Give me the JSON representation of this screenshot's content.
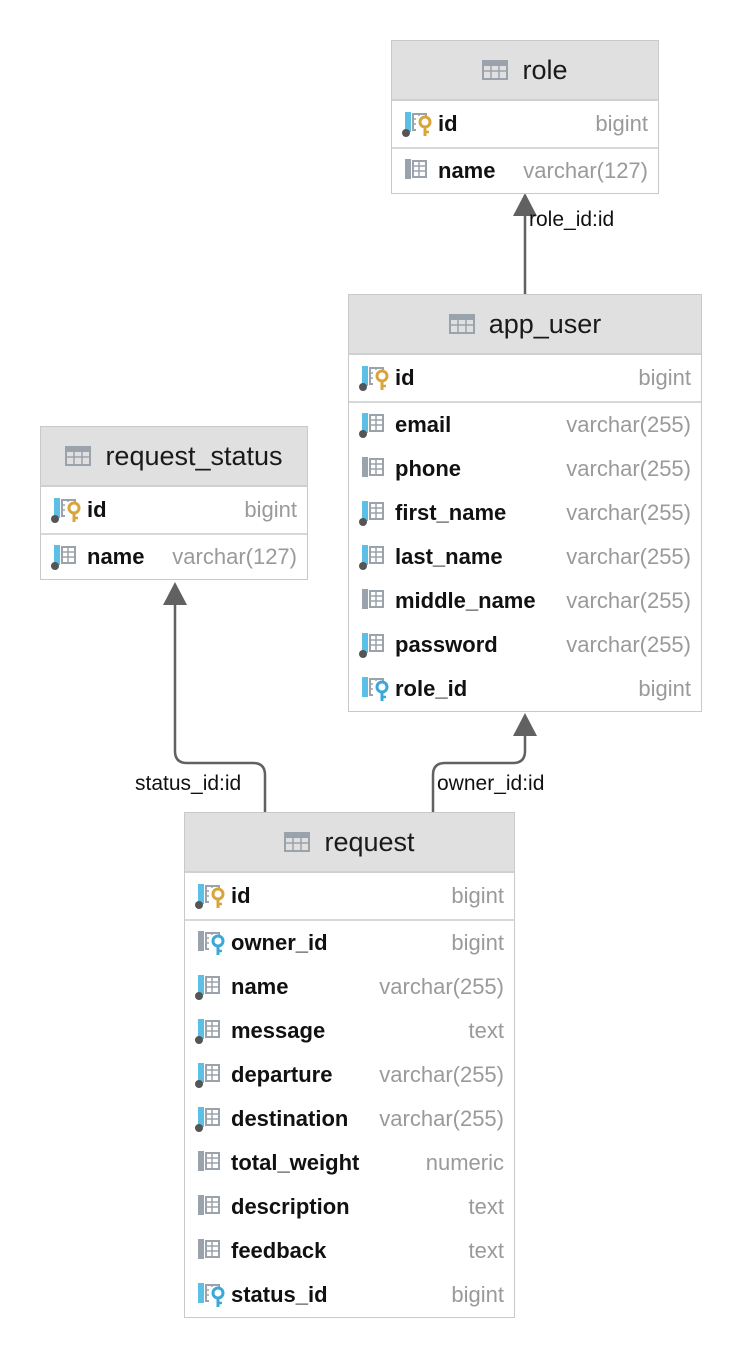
{
  "entities": {
    "role": {
      "title": "role",
      "columns": [
        {
          "name": "id",
          "type": "bigint",
          "kind": "pk"
        },
        {
          "name": "name",
          "type": "varchar(127)",
          "kind": "plain"
        }
      ]
    },
    "app_user": {
      "title": "app_user",
      "columns": [
        {
          "name": "id",
          "type": "bigint",
          "kind": "pk"
        },
        {
          "name": "email",
          "type": "varchar(255)",
          "kind": "notnull"
        },
        {
          "name": "phone",
          "type": "varchar(255)",
          "kind": "plain"
        },
        {
          "name": "first_name",
          "type": "varchar(255)",
          "kind": "notnull"
        },
        {
          "name": "last_name",
          "type": "varchar(255)",
          "kind": "notnull"
        },
        {
          "name": "middle_name",
          "type": "varchar(255)",
          "kind": "plain"
        },
        {
          "name": "password",
          "type": "varchar(255)",
          "kind": "notnull"
        },
        {
          "name": "role_id",
          "type": "bigint",
          "kind": "fk"
        }
      ]
    },
    "request_status": {
      "title": "request_status",
      "columns": [
        {
          "name": "id",
          "type": "bigint",
          "kind": "pk"
        },
        {
          "name": "name",
          "type": "varchar(127)",
          "kind": "notnull"
        }
      ]
    },
    "request": {
      "title": "request",
      "columns": [
        {
          "name": "id",
          "type": "bigint",
          "kind": "pk"
        },
        {
          "name": "owner_id",
          "type": "bigint",
          "kind": "fk-plain"
        },
        {
          "name": "name",
          "type": "varchar(255)",
          "kind": "notnull"
        },
        {
          "name": "message",
          "type": "text",
          "kind": "notnull"
        },
        {
          "name": "departure",
          "type": "varchar(255)",
          "kind": "notnull"
        },
        {
          "name": "destination",
          "type": "varchar(255)",
          "kind": "notnull"
        },
        {
          "name": "total_weight",
          "type": "numeric",
          "kind": "plain"
        },
        {
          "name": "description",
          "type": "text",
          "kind": "plain"
        },
        {
          "name": "feedback",
          "type": "text",
          "kind": "plain"
        },
        {
          "name": "status_id",
          "type": "bigint",
          "kind": "fk"
        }
      ]
    }
  },
  "relations": [
    {
      "label": "role_id:id"
    },
    {
      "label": "status_id:id"
    },
    {
      "label": "owner_id:id"
    }
  ],
  "colors": {
    "key": "#d9a53a",
    "fk": "#3aa8d8",
    "icon_blue": "#5bbfe6",
    "icon_gray": "#9aa3ab",
    "arrow": "#616161"
  }
}
